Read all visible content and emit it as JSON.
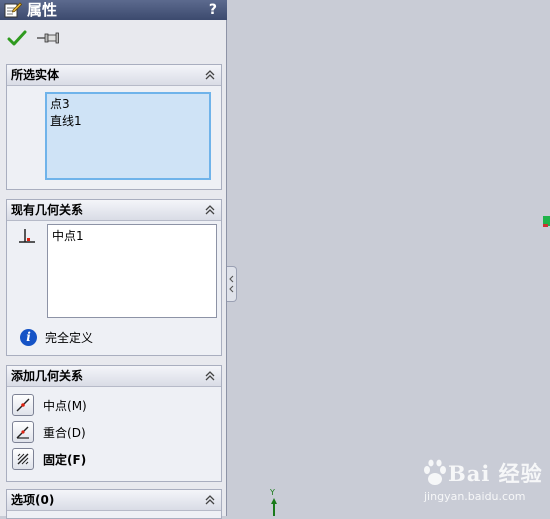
{
  "panel": {
    "title": "属性",
    "help": "?"
  },
  "groups": {
    "selected_entities": {
      "title": "所选实体",
      "items": [
        "点3",
        "直线1"
      ]
    },
    "existing_relations": {
      "title": "现有几何关系",
      "items": [
        "中点1"
      ],
      "status": "完全定义"
    },
    "add_relations": {
      "title": "添加几何关系",
      "items": [
        {
          "label": "中点",
          "shortcut": "(M)",
          "icon": "midpoint-relation-icon"
        },
        {
          "label": "重合",
          "shortcut": "(D)",
          "icon": "coincident-relation-icon"
        },
        {
          "label": "固定",
          "shortcut": "(F)",
          "icon": "fix-relation-icon"
        }
      ]
    },
    "options": {
      "title": "选项(0)"
    }
  },
  "viewport": {
    "axis_label": "Y"
  },
  "watermark": {
    "brand": "Bai 经验",
    "url": "jingyan.baidu.com"
  },
  "colors": {
    "accept_green": "#2f9a1f",
    "info_blue": "#1553c6",
    "selection_bg": "#cfe3f6",
    "title_bar": "#4a5778"
  }
}
